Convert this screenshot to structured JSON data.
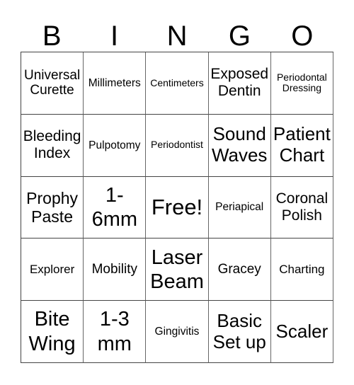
{
  "header": [
    "B",
    "I",
    "N",
    "G",
    "O"
  ],
  "cells": [
    "Universal\nCurette",
    "Millimeters",
    "Centimeters",
    "Exposed\nDentin",
    "Periodontal\nDressing",
    "Bleeding\nIndex",
    "Pulpotomy",
    "Periodontist",
    "Sound\nWaves",
    "Patient\nChart",
    "Prophy\nPaste",
    "1-\n6mm",
    "Free!",
    "Periapical",
    "Coronal\nPolish",
    "Explorer",
    "Mobility",
    "Laser\nBeam",
    "Gracey",
    "Charting",
    "Bite\nWing",
    "1-3\nmm",
    "Gingivitis",
    "Basic\nSet up",
    "Scaler"
  ]
}
